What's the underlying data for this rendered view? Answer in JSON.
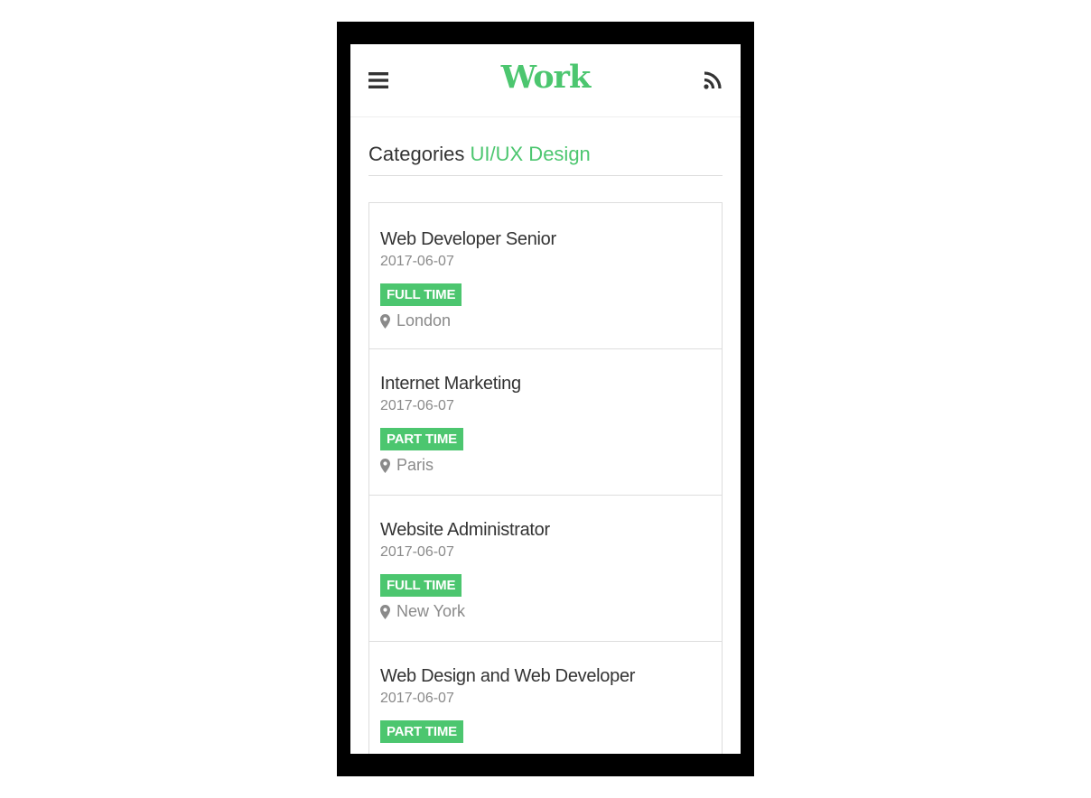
{
  "header": {
    "title": "Work",
    "menu_icon": "hamburger-menu-icon",
    "feed_icon": "rss-feed-icon"
  },
  "category": {
    "label": "Categories",
    "value": "UI/UX Design"
  },
  "jobs": [
    {
      "title": "Web Developer Senior",
      "date": "2017-06-07",
      "type": "FULL TIME",
      "location": "London"
    },
    {
      "title": "Internet Marketing",
      "date": "2017-06-07",
      "type": "PART TIME",
      "location": "Paris"
    },
    {
      "title": "Website Administrator",
      "date": "2017-06-07",
      "type": "FULL TIME",
      "location": "New York"
    },
    {
      "title": "Web Design and Web Developer",
      "date": "2017-06-07",
      "type": "PART TIME",
      "location": ""
    }
  ],
  "colors": {
    "accent": "#4cc66f",
    "text": "#333333",
    "muted": "#8a8a8a",
    "frame": "#000000"
  }
}
